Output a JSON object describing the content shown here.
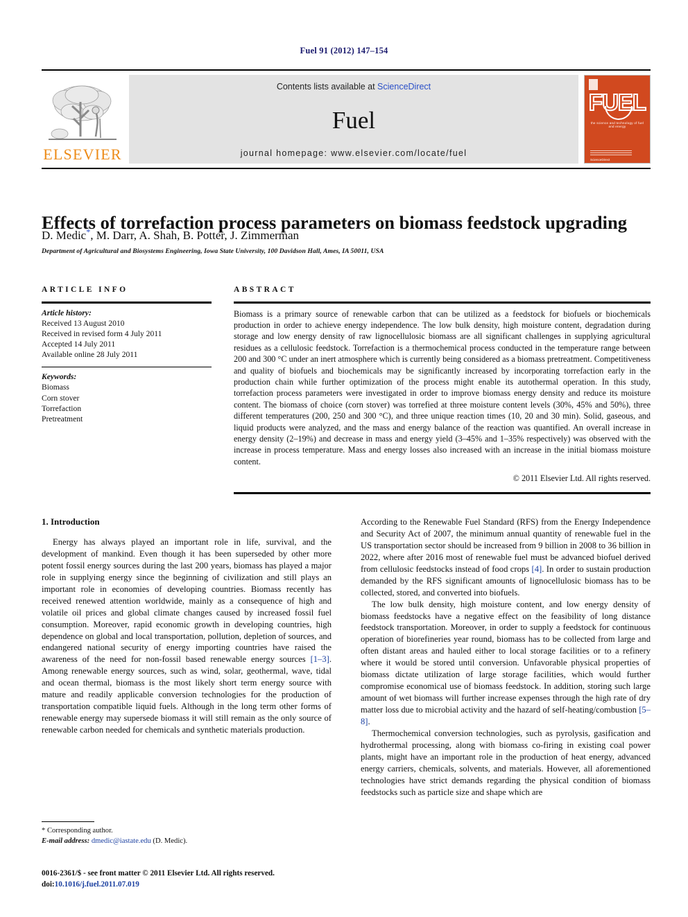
{
  "running_head": "Fuel 91 (2012) 147–154",
  "header": {
    "publisher": "ELSEVIER",
    "contents_text": "Contents lists available at ",
    "contents_link": "ScienceDirect",
    "journal_name": "Fuel",
    "homepage": "journal homepage: www.elsevier.com/locate/fuel",
    "cover": {
      "wordmark": "FUEL",
      "tagline": "the science and technology of fuel and energy",
      "footer_word": "ScienceDirect"
    }
  },
  "article": {
    "title": "Effects of torrefaction process parameters on biomass feedstock upgrading",
    "authors": "D. Medic, M. Darr, A. Shah, B. Potter, J. Zimmerman",
    "author_marker": "*",
    "affiliation": "Department of Agricultural and Biosystems Engineering, Iowa State University, 100 Davidson Hall, Ames, IA 50011, USA"
  },
  "article_info": {
    "heading": "ARTICLE INFO",
    "history_label": "Article history:",
    "history": [
      "Received 13 August 2010",
      "Received in revised form 4 July 2011",
      "Accepted 14 July 2011",
      "Available online 28 July 2011"
    ],
    "keywords_label": "Keywords:",
    "keywords": [
      "Biomass",
      "Corn stover",
      "Torrefaction",
      "Pretreatment"
    ]
  },
  "abstract": {
    "heading": "ABSTRACT",
    "text": "Biomass is a primary source of renewable carbon that can be utilized as a feedstock for biofuels or biochemicals production in order to achieve energy independence. The low bulk density, high moisture content, degradation during storage and low energy density of raw lignocellulosic biomass are all significant challenges in supplying agricultural residues as a cellulosic feedstock. Torrefaction is a thermochemical process conducted in the temperature range between 200 and 300 °C under an inert atmosphere which is currently being considered as a biomass pretreatment. Competitiveness and quality of biofuels and biochemicals may be significantly increased by incorporating torrefaction early in the production chain while further optimization of the process might enable its autothermal operation. In this study, torrefaction process parameters were investigated in order to improve biomass energy density and reduce its moisture content. The biomass of choice (corn stover) was torrefied at three moisture content levels (30%, 45% and 50%), three different temperatures (200, 250 and 300 °C), and three unique reaction times (10, 20 and 30 min). Solid, gaseous, and liquid products were analyzed, and the mass and energy balance of the reaction was quantified. An overall increase in energy density (2–19%) and decrease in mass and energy yield (3–45% and 1–35% respectively) was observed with the increase in process temperature. Mass and energy losses also increased with an increase in the initial biomass moisture content.",
    "copyright": "© 2011 Elsevier Ltd. All rights reserved."
  },
  "body": {
    "section_heading": "1. Introduction",
    "left_paragraphs": [
      "Energy has always played an important role in life, survival, and the development of mankind. Even though it has been superseded by other more potent fossil energy sources during the last 200 years, biomass has played a major role in supplying energy since the beginning of civilization and still plays an important role in economies of developing countries. Biomass recently has received renewed attention worldwide, mainly as a consequence of high and volatile oil prices and global climate changes caused by increased fossil fuel consumption. Moreover, rapid economic growth in developing countries, high dependence on global and local transportation, pollution, depletion of sources, and endangered national security of energy importing countries have raised the awareness of the need for non-fossil based renewable energy sources [1–3]. Among renewable energy sources, such as wind, solar, geothermal, wave, tidal and ocean thermal, biomass is the most likely short term energy source with mature and readily applicable conversion technologies for the production of transportation compatible liquid fuels. Although in the long term other forms of renewable energy may supersede biomass it will still remain as the only source of renewable carbon needed for chemicals and synthetic materials production."
    ],
    "right_paragraphs": [
      "According to the Renewable Fuel Standard (RFS) from the Energy Independence and Security Act of 2007, the minimum annual quantity of renewable fuel in the US transportation sector should be increased from 9 billion in 2008 to 36 billion in 2022, where after 2016 most of renewable fuel must be advanced biofuel derived from cellulosic feedstocks instead of food crops [4]. In order to sustain production demanded by the RFS significant amounts of lignocellulosic biomass has to be collected, stored, and converted into biofuels.",
      "The low bulk density, high moisture content, and low energy density of biomass feedstocks have a negative effect on the feasibility of long distance feedstock transportation. Moreover, in order to supply a feedstock for continuous operation of biorefineries year round, biomass has to be collected from large and often distant areas and hauled either to local storage facilities or to a refinery where it would be stored until conversion. Unfavorable physical properties of biomass dictate utilization of large storage facilities, which would further compromise economical use of biomass feedstock. In addition, storing such large amount of wet biomass will further increase expenses through the high rate of dry matter loss due to microbial activity and the hazard of self-heating/combustion [5–8].",
      "Thermochemical conversion technologies, such as pyrolysis, gasification and hydrothermal processing, along with biomass co-firing in existing coal power plants, might have an important role in the production of heat energy, advanced energy carriers, chemicals, solvents, and materials. However, all aforementioned technologies have strict demands regarding the physical condition of biomass feedstocks such as particle size and shape which are"
    ]
  },
  "footnote": {
    "corresponding": "* Corresponding author.",
    "email_label": "E-mail address:",
    "email": "dmedic@iastate.edu",
    "email_suffix": "(D. Medic)."
  },
  "footer": {
    "issn_line": "0016-2361/$ - see front matter © 2011 Elsevier Ltd. All rights reserved.",
    "doi_label": "doi:",
    "doi": "10.1016/j.fuel.2011.07.019"
  },
  "colors": {
    "elsevier_orange": "#ED8B18",
    "cover_red": "#D1491F",
    "link_blue": "#2b50c8",
    "ref_blue": "#1a3fa0",
    "runhead_navy": "#1a1a6e",
    "band_gray": "#e3e3e3"
  }
}
